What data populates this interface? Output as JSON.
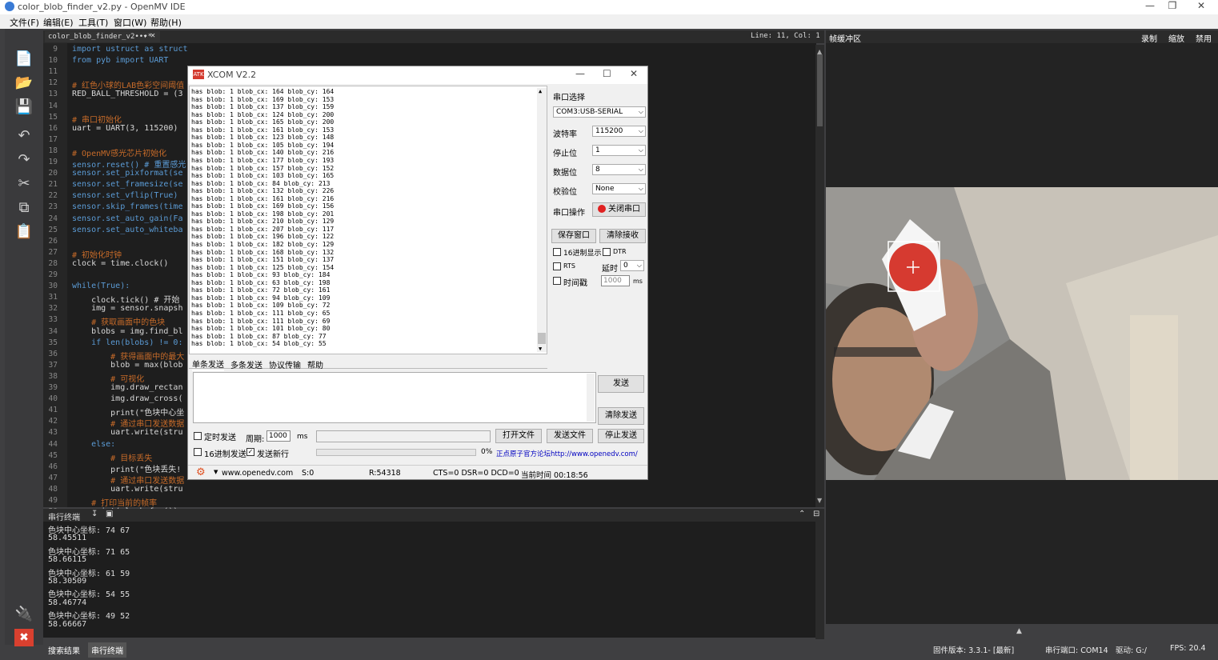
{
  "window": {
    "title": "color_blob_finder_v2.py - OpenMV IDE"
  },
  "menu": [
    "文件(F)",
    "编辑(E)",
    "工具(T)",
    "窗口(W)",
    "帮助(H)"
  ],
  "editor": {
    "tab_label": "color_blob_finder_v2•••*",
    "cursor": "Line: 11, Col: 1",
    "lines": [
      {
        "n": "9",
        "t": "import ustruct as struct",
        "c": "kw"
      },
      {
        "n": "10",
        "t": "from pyb import UART",
        "c": "kw"
      },
      {
        "n": "11",
        "t": "",
        "c": "df"
      },
      {
        "n": "12",
        "t": "# 红色小球的LAB色彩空间阈值",
        "c": "cm"
      },
      {
        "n": "13",
        "t": "RED_BALL_THRESHOLD = (3",
        "c": "df"
      },
      {
        "n": "14",
        "t": "",
        "c": "df"
      },
      {
        "n": "15",
        "t": "# 串口初始化",
        "c": "cm"
      },
      {
        "n": "16",
        "t": "uart = UART(3, 115200)",
        "c": "df"
      },
      {
        "n": "17",
        "t": "",
        "c": "df"
      },
      {
        "n": "18",
        "t": "# OpenMV感光芯片初始化",
        "c": "cm"
      },
      {
        "n": "19",
        "t": "sensor.reset() # 重置感光",
        "c": "kw"
      },
      {
        "n": "20",
        "t": "sensor.set_pixformat(se",
        "c": "kw"
      },
      {
        "n": "21",
        "t": "sensor.set_framesize(se",
        "c": "kw"
      },
      {
        "n": "22",
        "t": "sensor.set_vflip(True)",
        "c": "kw"
      },
      {
        "n": "23",
        "t": "sensor.skip_frames(time",
        "c": "kw"
      },
      {
        "n": "24",
        "t": "sensor.set_auto_gain(Fa",
        "c": "kw"
      },
      {
        "n": "25",
        "t": "sensor.set_auto_whiteba",
        "c": "kw"
      },
      {
        "n": "26",
        "t": "",
        "c": "df"
      },
      {
        "n": "27",
        "t": "# 初始化时钟",
        "c": "cm"
      },
      {
        "n": "28",
        "t": "clock = time.clock()",
        "c": "df"
      },
      {
        "n": "29",
        "t": "",
        "c": "df"
      },
      {
        "n": "30",
        "t": "while(True):",
        "c": "kw"
      },
      {
        "n": "31",
        "t": "    clock.tick() # 开始",
        "c": "df"
      },
      {
        "n": "32",
        "t": "    img = sensor.snapsh",
        "c": "df"
      },
      {
        "n": "33",
        "t": "    # 获取画面中的色块",
        "c": "cm"
      },
      {
        "n": "34",
        "t": "    blobs = img.find_bl",
        "c": "df"
      },
      {
        "n": "35",
        "t": "    if len(blobs) != 0:",
        "c": "kw"
      },
      {
        "n": "36",
        "t": "        # 获得画面中的最大",
        "c": "cm"
      },
      {
        "n": "37",
        "t": "        blob = max(blob",
        "c": "df"
      },
      {
        "n": "38",
        "t": "        # 可视化",
        "c": "cm"
      },
      {
        "n": "39",
        "t": "        img.draw_rectan",
        "c": "df"
      },
      {
        "n": "40",
        "t": "        img.draw_cross(",
        "c": "df"
      },
      {
        "n": "41",
        "t": "        print(\"色块中心坐",
        "c": "df"
      },
      {
        "n": "42",
        "t": "        # 通过串口发送数据",
        "c": "cm"
      },
      {
        "n": "43",
        "t": "        uart.write(stru",
        "c": "df"
      },
      {
        "n": "44",
        "t": "    else:",
        "c": "kw"
      },
      {
        "n": "45",
        "t": "        # 目标丢失",
        "c": "cm"
      },
      {
        "n": "46",
        "t": "        print(\"色块丢失!",
        "c": "df"
      },
      {
        "n": "47",
        "t": "        # 通过串口发送数据",
        "c": "cm"
      },
      {
        "n": "48",
        "t": "        uart.write(stru",
        "c": "df"
      },
      {
        "n": "49",
        "t": "    # 打印当前的帧率",
        "c": "cm"
      },
      {
        "n": "50",
        "t": "    print(clock.fps())",
        "c": "df"
      }
    ]
  },
  "terminal": {
    "title": "串行终端",
    "lines": [
      "色块中心坐标: 74 67",
      "58.45511",
      "色块中心坐标: 71 65",
      "58.66115",
      "色块中心坐标: 61 59",
      "58.30509",
      "色块中心坐标: 54 55",
      "58.46774",
      "色块中心坐标: 49 52",
      "58.66667"
    ]
  },
  "bottom_tabs": [
    "搜索结果",
    "串行终端"
  ],
  "status": {
    "firmware": "固件版本: 3.3.1- [最新]",
    "port": "串行端口: COM14",
    "drive": "驱动: G:/",
    "fps": "FPS: 20.4"
  },
  "framebuffer": {
    "title": "帧缓冲区",
    "record": "录制",
    "zoom": "缩放",
    "disable": "禁用"
  },
  "xcom": {
    "title": "XCOM V2.2",
    "recv_lines": [
      "has blob: 1 blob_cx: 164 blob_cy: 164",
      "has blob: 1 blob_cx: 169 blob_cy: 153",
      "has blob: 1 blob_cx: 137 blob_cy: 159",
      "has blob: 1 blob_cx: 124 blob_cy: 200",
      "has blob: 1 blob_cx: 165 blob_cy: 200",
      "has blob: 1 blob_cx: 161 blob_cy: 153",
      "has blob: 1 blob_cx: 123 blob_cy: 148",
      "has blob: 1 blob_cx: 105 blob_cy: 194",
      "has blob: 1 blob_cx: 140 blob_cy: 216",
      "has blob: 1 blob_cx: 177 blob_cy: 193",
      "has blob: 1 blob_cx: 157 blob_cy: 152",
      "has blob: 1 blob_cx: 103 blob_cy: 165",
      "has blob: 1 blob_cx: 84 blob_cy: 213",
      "has blob: 1 blob_cx: 132 blob_cy: 226",
      "has blob: 1 blob_cx: 161 blob_cy: 216",
      "has blob: 1 blob_cx: 169 blob_cy: 156",
      "has blob: 1 blob_cx: 198 blob_cy: 201",
      "has blob: 1 blob_cx: 210 blob_cy: 129",
      "has blob: 1 blob_cx: 207 blob_cy: 117",
      "has blob: 1 blob_cx: 196 blob_cy: 122",
      "has blob: 1 blob_cx: 182 blob_cy: 129",
      "has blob: 1 blob_cx: 168 blob_cy: 132",
      "has blob: 1 blob_cx: 151 blob_cy: 137",
      "has blob: 1 blob_cx: 125 blob_cy: 154",
      "has blob: 1 blob_cx: 93 blob_cy: 184",
      "has blob: 1 blob_cx: 63 blob_cy: 198",
      "has blob: 1 blob_cx: 72 blob_cy: 161",
      "has blob: 1 blob_cx: 94 blob_cy: 109",
      "has blob: 1 blob_cx: 109 blob_cy: 72",
      "has blob: 1 blob_cx: 111 blob_cy: 65",
      "has blob: 1 blob_cx: 111 blob_cy: 69",
      "has blob: 1 blob_cx: 101 blob_cy: 80",
      "has blob: 1 blob_cx: 87 blob_cy: 77",
      "has blob: 1 blob_cx: 54 blob_cy: 55"
    ],
    "port_select_label": "串口选择",
    "port_value": "COM3:USB-SERIAL",
    "baud_label": "波特率",
    "baud_value": "115200",
    "stop_label": "停止位",
    "stop_value": "1",
    "data_label": "数据位",
    "data_value": "8",
    "parity_label": "校验位",
    "parity_value": "None",
    "op_label": "串口操作",
    "close_port": "关闭串口",
    "save_window": "保存窗口",
    "clear_recv": "清除接收",
    "hex_display": "16进制显示",
    "dtr": "DTR",
    "rts": "RTS",
    "delay_label": "延时",
    "delay_value": "0",
    "timestamp": "时间戳",
    "ts_value": "1000",
    "ms": "ms",
    "tabs": [
      "单条发送",
      "多条发送",
      "协议传输",
      "帮助"
    ],
    "send": "发送",
    "clear_send": "清除发送",
    "timed_send": "定时发送",
    "period_label": "周期:",
    "period_value": "1000",
    "period_unit": "ms",
    "open_file": "打开文件",
    "send_file": "发送文件",
    "stop_send": "停止发送",
    "hex_send": "16进制发送",
    "send_newline": "发送新行",
    "percent": "0%",
    "forum": "正点原子官方论坛http://www.openedv.com/",
    "sb_url": "www.openedv.com",
    "sb_s": "S:0",
    "sb_r": "R:54318",
    "sb_lines": "CTS=0 DSR=0 DCD=0",
    "sb_time": "当前时间 00:18:56"
  }
}
